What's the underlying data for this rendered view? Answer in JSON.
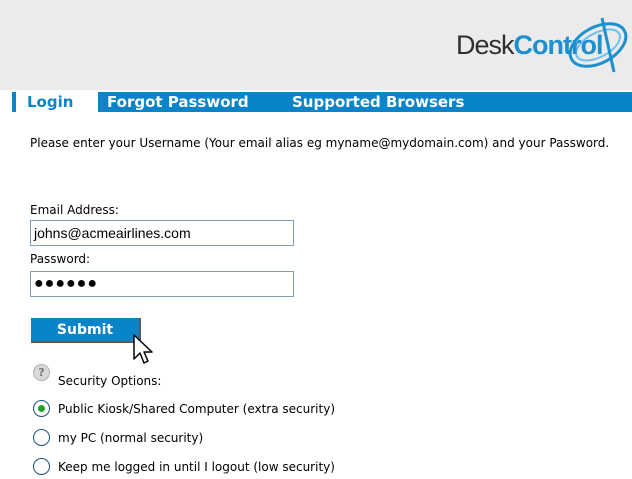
{
  "logo": {
    "part1": "Desk",
    "part2": "Control"
  },
  "tabs": {
    "login": "Login",
    "forgot_password": "Forgot Password",
    "supported_browsers": "Supported Browsers"
  },
  "form": {
    "instructions": "Please enter your Username (Your email alias eg myname@mydomain.com) and your Password.",
    "email_label": "Email Address:",
    "email_value": "johns@acmeairlines.com",
    "password_label": "Password:",
    "password_value": "●●●●●●",
    "submit_label": "Submit"
  },
  "security": {
    "label": "Security Options:",
    "help_icon": "question-mark-icon",
    "selected_index": 0,
    "options": [
      "Public Kiosk/Shared Computer (extra security)",
      "my PC (normal security)",
      "Keep me logged in until I logout (low security)"
    ]
  },
  "colors": {
    "accent": "#0a84c8",
    "header_bg": "#ebebeb",
    "radio_selected": "#22a22a"
  }
}
